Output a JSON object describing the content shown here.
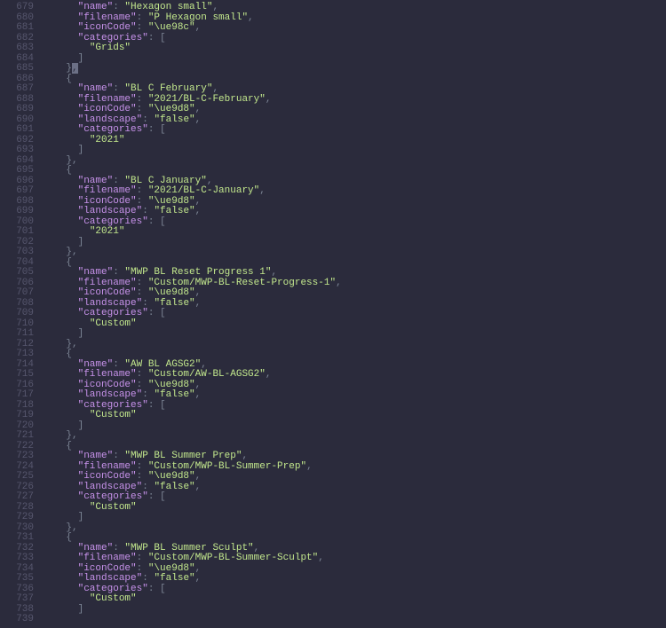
{
  "gutter": [
    "679",
    "680",
    "681",
    "682",
    "683",
    "684",
    "685",
    "686",
    "687",
    "688",
    "689",
    "690",
    "691",
    "692",
    "693",
    "694",
    "695",
    "696",
    "697",
    "698",
    "699",
    "700",
    "701",
    "702",
    "703",
    "704",
    "705",
    "706",
    "707",
    "708",
    "709",
    "710",
    "711",
    "712",
    "713",
    "714",
    "715",
    "716",
    "717",
    "718",
    "719",
    "720",
    "721",
    "722",
    "723",
    "724",
    "725",
    "726",
    "727",
    "728",
    "729",
    "730",
    "731",
    "732",
    "733",
    "734",
    "735",
    "736",
    "737",
    "738",
    "739"
  ],
  "keys": {
    "name": "\"name\"",
    "filename": "\"filename\"",
    "iconCode": "\"iconCode\"",
    "categories": "\"categories\"",
    "landscape": "\"landscape\""
  },
  "vals": {
    "false": "\"false\"",
    "grids": "\"Grids\"",
    "y2021": "\"2021\"",
    "custom": "\"Custom\""
  },
  "items": [
    {
      "name": "\"Hexagon small\"",
      "filename": "\"P Hexagon small\"",
      "iconCode": "\"\\ue98c\"",
      "cats": [
        "Grids"
      ]
    },
    {
      "name": "\"BL C February\"",
      "filename": "\"2021/BL-C-February\"",
      "iconCode": "\"\\ue9d8\"",
      "landscape": "\"false\"",
      "cats": [
        "2021"
      ]
    },
    {
      "name": "\"BL C January\"",
      "filename": "\"2021/BL-C-January\"",
      "iconCode": "\"\\ue9d8\"",
      "landscape": "\"false\"",
      "cats": [
        "2021"
      ]
    },
    {
      "name": "\"MWP BL Reset Progress 1\"",
      "filename": "\"Custom/MWP-BL-Reset-Progress-1\"",
      "iconCode": "\"\\ue9d8\"",
      "landscape": "\"false\"",
      "cats": [
        "Custom"
      ]
    },
    {
      "name": "\"AW BL AGSG2\"",
      "filename": "\"Custom/AW-BL-AGSG2\"",
      "iconCode": "\"\\ue9d8\"",
      "landscape": "\"false\"",
      "cats": [
        "Custom"
      ]
    },
    {
      "name": "\"MWP BL Summer Prep\"",
      "filename": "\"Custom/MWP-BL-Summer-Prep\"",
      "iconCode": "\"\\ue9d8\"",
      "landscape": "\"false\"",
      "cats": [
        "Custom"
      ]
    },
    {
      "name": "\"MWP BL Summer Sculpt\"",
      "filename": "\"Custom/MWP-BL-Summer-Sculpt\"",
      "iconCode": "\"\\ue9d8\"",
      "landscape": "\"false\"",
      "cats": [
        "Custom"
      ]
    }
  ]
}
